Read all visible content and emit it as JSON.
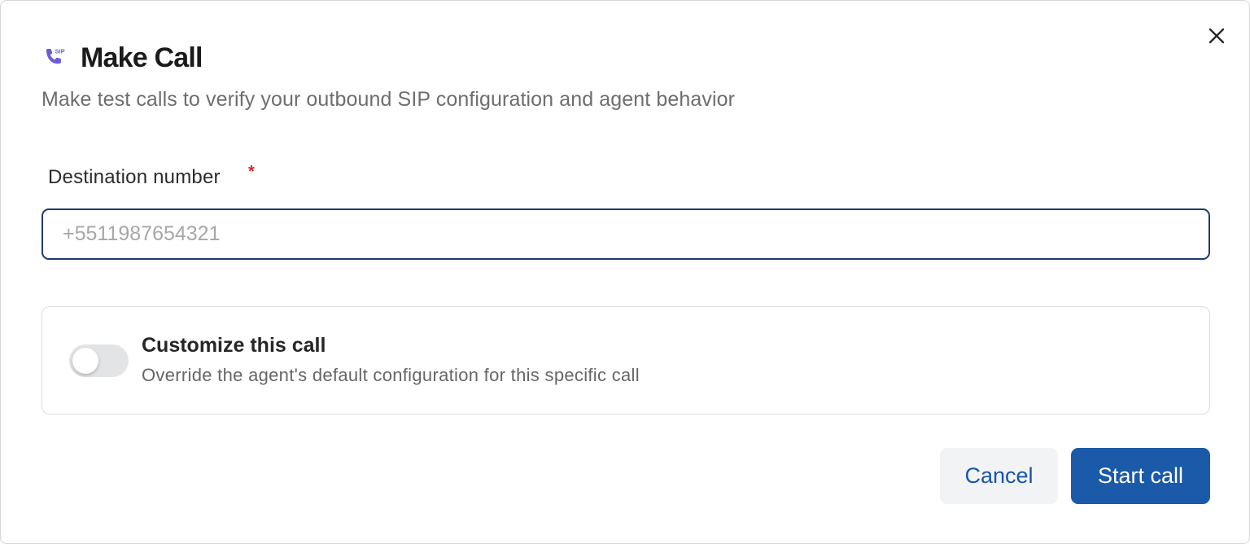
{
  "dialog": {
    "title": "Make Call",
    "title_icon": "sip-phone-icon",
    "subtitle": "Make test calls to verify your outbound SIP configuration and agent behavior",
    "close_icon": "close-icon",
    "sip_icon_text": "SIP"
  },
  "form": {
    "destination_label": "Destination number",
    "required_marker": "*",
    "destination_placeholder": "+5511987654321",
    "destination_value": ""
  },
  "customize": {
    "title": "Customize this call",
    "description": "Override the agent's default configuration for this specific call",
    "enabled": false
  },
  "actions": {
    "cancel_label": "Cancel",
    "start_label": "Start call"
  },
  "colors": {
    "accent": "#1a5aa8",
    "icon_purple": "#6b5bd6",
    "required": "#d6262e",
    "input_border": "#1e3a70"
  }
}
